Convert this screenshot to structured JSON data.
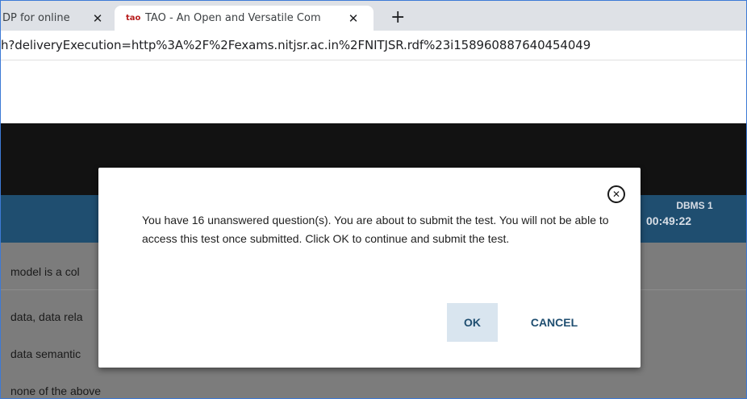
{
  "browser": {
    "tabs": [
      {
        "label": "DP for online",
        "active": false
      },
      {
        "label": "TAO - An Open and Versatile Com",
        "favicon": "tao",
        "active": true
      }
    ],
    "new_tab_symbol": "+",
    "url": "h?deliveryExecution=http%3A%2F%2Fexams.nitjsr.ac.in%2FNITJSR.rdf%23i158960887640454049"
  },
  "test_header": {
    "title": "DBMS 1",
    "timer": "00:49:22"
  },
  "question": {
    "text": "model is a col",
    "options": [
      "data, data rela",
      "data semantic",
      "none of the above"
    ]
  },
  "dialog": {
    "message": "You have 16 unanswered question(s). You are about to submit the test. You will not be able to access this test once submitted. Click OK to continue and submit the test.",
    "ok_label": "OK",
    "cancel_label": "CANCEL"
  },
  "colors": {
    "header_bar": "#1f4e70",
    "button_text": "#1f4e70",
    "ok_bg": "#d9e5ef",
    "overlay": "#7c7c7c"
  }
}
